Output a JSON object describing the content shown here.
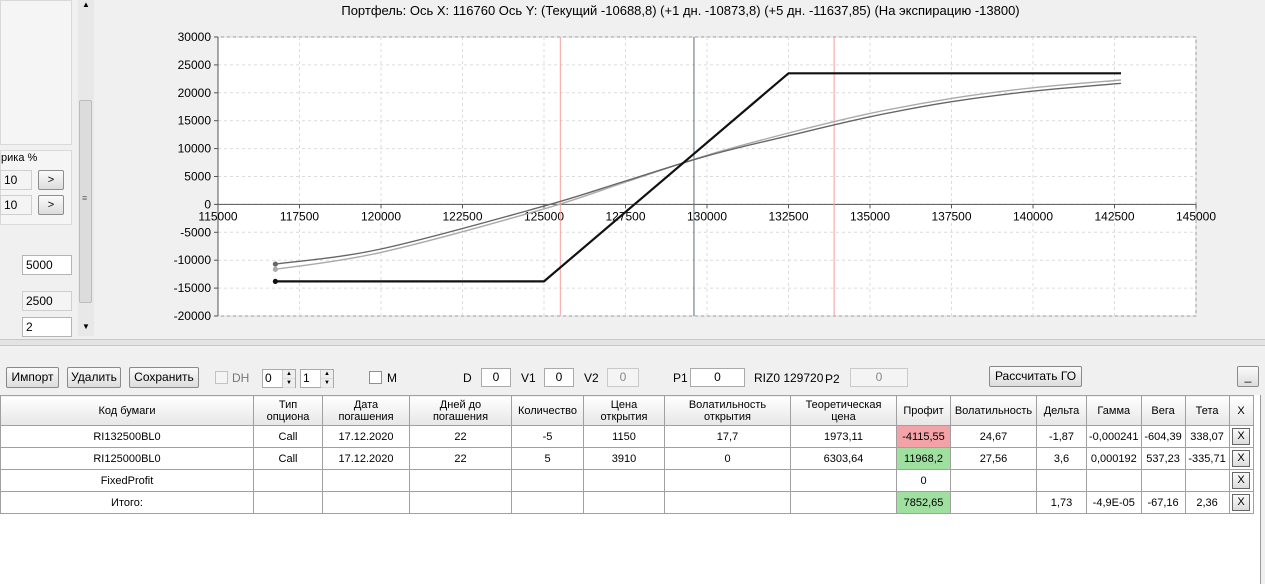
{
  "left_panel": {
    "label_fragment": "рика %",
    "field1": "10",
    "field2": "10",
    "arrow_label": ">",
    "field3": "5000",
    "field4": "2500",
    "field5": "2"
  },
  "chart_title": "Портфель: Ось X: 116760 Ось Y:  (Текущий -10688,8)  (+1 дн. -10873,8)  (+5 дн. -11637,85)  (На экспирацию -13800)",
  "chart_data": {
    "type": "line",
    "title": "Портфель: Ось X: 116760 Ось Y:  (Текущий -10688,8)  (+1 дн. -10873,8)  (+5 дн. -11637,85)  (На экспирацию -13800)",
    "xlim": [
      115000,
      145000
    ],
    "ylim": [
      -20000,
      30000
    ],
    "x_ticks": [
      "115000",
      "117500",
      "120000",
      "122500",
      "125000",
      "127500",
      "130000",
      "132500",
      "135000",
      "137500",
      "140000",
      "142500",
      "145000"
    ],
    "y_ticks": [
      "30000",
      "25000",
      "20000",
      "15000",
      "10000",
      "5000",
      "0",
      "-5000",
      "-10000",
      "-15000",
      "-20000"
    ],
    "grid": true,
    "vertical_lines": [
      {
        "x": 125500,
        "color": "#f4a0a0"
      },
      {
        "x": 129600,
        "color": "#5a6a80"
      },
      {
        "x": 133900,
        "color": "#f4a0a0"
      }
    ],
    "series": [
      {
        "color": "#111111",
        "x": [
          116760,
          125000,
          132500,
          142700
        ],
        "y": [
          -13800,
          -13800,
          23500,
          23500
        ]
      },
      {
        "color": "#666666",
        "x": [
          116760,
          120000,
          125000,
          127500,
          130000,
          132500,
          135000,
          137500,
          140000,
          142700
        ],
        "y": [
          -10689,
          -8000,
          -300,
          4200,
          8700,
          12300,
          15700,
          18400,
          20300,
          21700
        ]
      },
      {
        "color": "#aaaaaa",
        "x": [
          116760,
          120000,
          125000,
          127500,
          130000,
          132500,
          135000,
          137500,
          140000,
          142700
        ],
        "y": [
          -11638,
          -8600,
          -800,
          4000,
          8800,
          12800,
          16300,
          19000,
          20900,
          22300
        ]
      }
    ]
  },
  "toolbar": {
    "import": "Импорт",
    "delete": "Удалить",
    "save": "Сохранить",
    "dh": "DH",
    "spin1": "0",
    "spin2": "1",
    "m": "M",
    "d_label": "D",
    "d_value": "0",
    "v1_label": "V1",
    "v1_value": "0",
    "v2_label": "V2",
    "v2_value": "0",
    "p1_label": "P1",
    "p1_value": "0",
    "riz": "RIZ0 129720",
    "p2_label": "P2",
    "p2_value": "0",
    "calc": "Рассчитать ГО",
    "minimize": "_"
  },
  "grid": {
    "columns": [
      {
        "label": "Код бумаги",
        "w": 253
      },
      {
        "label": "Тип опциона",
        "w": 69
      },
      {
        "label": "Дата погашения",
        "w": 87
      },
      {
        "label": "Дней до погашения",
        "w": 102
      },
      {
        "label": "Количество",
        "w": 72
      },
      {
        "label": "Цена открытия",
        "w": 81
      },
      {
        "label": "Волатильность открытия",
        "w": 126
      },
      {
        "label": "Теоретическая цена",
        "w": 106
      },
      {
        "label": "Профит",
        "w": 54
      },
      {
        "label": "Волатильность",
        "w": 86
      },
      {
        "label": "Дельта",
        "w": 50
      },
      {
        "label": "Гамма",
        "w": 52
      },
      {
        "label": "Вега",
        "w": 44
      },
      {
        "label": "Тета",
        "w": 44
      },
      {
        "label": "X",
        "w": 24
      }
    ],
    "rows": [
      {
        "cells": [
          "RI132500BL0",
          "Call",
          "17.12.2020",
          "22",
          "-5",
          "1150",
          "17,7",
          "1973,11",
          "-4115,55",
          "24,67",
          "-1,87",
          "-0,000241",
          "-604,39",
          "338,07"
        ],
        "profit": "neg",
        "x": "X"
      },
      {
        "cells": [
          "RI125000BL0",
          "Call",
          "17.12.2020",
          "22",
          "5",
          "3910",
          "0",
          "6303,64",
          "11968,2",
          "27,56",
          "3,6",
          "0,000192",
          "537,23",
          "-335,71"
        ],
        "profit": "pos",
        "x": "X"
      },
      {
        "cells": [
          "FixedProfit",
          "",
          "",
          "",
          "",
          "",
          "",
          "",
          "0",
          "",
          "",
          "",
          "",
          ""
        ],
        "profit": "",
        "x": "X"
      },
      {
        "cells": [
          "Итого:",
          "",
          "",
          "",
          "",
          "",
          "",
          "",
          "7852,65",
          "",
          "1,73",
          "-4,9E-05",
          "-67,16",
          "2,36"
        ],
        "profit": "pos",
        "x": "X"
      }
    ]
  }
}
